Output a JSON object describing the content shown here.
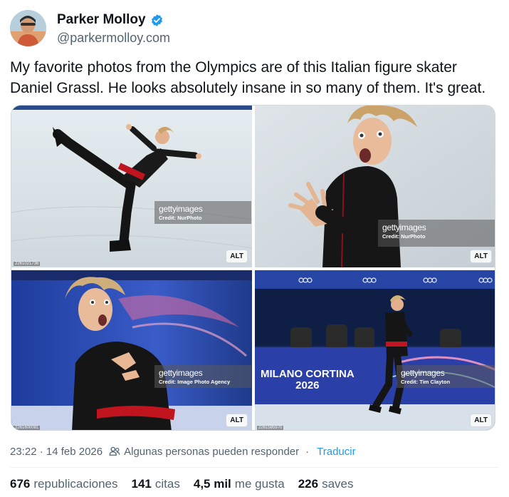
{
  "author": {
    "display_name": "Parker Molloy",
    "handle": "@parkermolloy.com",
    "verified": true,
    "avatar_icon": "avatar-photo"
  },
  "tweet": {
    "text": "My favorite photos from the Olympics are of this Italian figure skater Daniel Grassl. He looks absolutely insane in so many of them. It's great."
  },
  "media": [
    {
      "getty_brand": "getty",
      "getty_suffix": "images",
      "credit": "Credit: NurPhoto",
      "image_id": "2261021736",
      "alt_label": "ALT"
    },
    {
      "getty_brand": "getty",
      "getty_suffix": "images",
      "credit": "Credit: NurPhoto",
      "image_id": "",
      "alt_label": "ALT"
    },
    {
      "getty_brand": "getty",
      "getty_suffix": "images",
      "credit": "Credit: Image Photo Agency",
      "image_id": "2261600081",
      "alt_label": "ALT"
    },
    {
      "getty_brand": "getty",
      "getty_suffix": "images",
      "credit": "Credit: Tim Clayton",
      "image_id": "2261585970",
      "alt_label": "ALT",
      "banner": "MILANO CORTINA",
      "banner_year": "2026"
    }
  ],
  "meta": {
    "timestamp": "23:22 · 14 feb 2026",
    "reply_setting": "Algunas personas pueden responder",
    "separator": "·",
    "translate": "Traducir"
  },
  "stats": [
    {
      "count": "676",
      "label": "republicaciones"
    },
    {
      "count": "141",
      "label": "citas"
    },
    {
      "count": "4,5 mil",
      "label": "me gusta"
    },
    {
      "count": "226",
      "label": "saves"
    }
  ],
  "colors": {
    "accent": "#1d9bf0",
    "text": "#0f1419",
    "secondary": "#536471",
    "costume_red": "#c0141f"
  }
}
